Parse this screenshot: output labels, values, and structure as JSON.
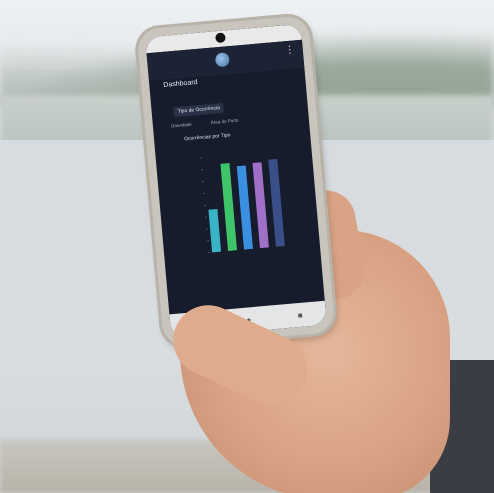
{
  "app": {
    "title": "Dashboard",
    "filter_button": "Tipo de Ocorrência",
    "chips": [
      "Gravidade",
      "Área do Porto"
    ],
    "chart_title": "Ocorrências por Tipo"
  },
  "icons": {
    "menu": "more-vert-icon",
    "back": "back-icon",
    "home": "home-icon",
    "recents": "recents-icon"
  },
  "colors": {
    "screen_bg": "#161c2b",
    "bar_colors": [
      "#39b3c8",
      "#3fc46a",
      "#3a8fe0",
      "#a070c8",
      "#3a4f8a"
    ]
  },
  "chart_data": {
    "type": "bar",
    "categories": [
      "",
      "",
      "",
      "",
      ""
    ],
    "values": [
      0.45,
      0.92,
      0.88,
      0.9,
      0.92
    ],
    "title": "Ocorrências por Tipo"
  }
}
